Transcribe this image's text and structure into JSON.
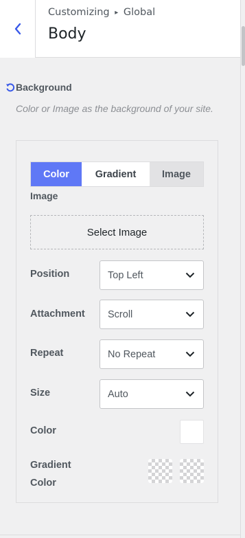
{
  "header": {
    "breadcrumb_parent": "Customizing",
    "breadcrumb_separator": "▸",
    "breadcrumb_child": "Global",
    "title": "Body"
  },
  "section": {
    "label": "Background",
    "description": "Color or Image as the background of your site."
  },
  "tabs": [
    {
      "label": "Color",
      "active": true
    },
    {
      "label": "Gradient",
      "active": false
    },
    {
      "label": "Image",
      "active": false
    }
  ],
  "image": {
    "label": "Image",
    "select_button": "Select Image"
  },
  "fields": {
    "position": {
      "label": "Position",
      "value": "Top Left"
    },
    "attachment": {
      "label": "Attachment",
      "value": "Scroll"
    },
    "repeat": {
      "label": "Repeat",
      "value": "No Repeat"
    },
    "size": {
      "label": "Size",
      "value": "Auto"
    },
    "color": {
      "label": "Color",
      "value": "#ffffff"
    },
    "gradient": {
      "label_line1": "Gradient",
      "label_line2": "Color"
    }
  },
  "colors": {
    "accent": "#5f78f6",
    "back_arrow": "#3858e9"
  },
  "icons": {
    "back": "chevron-left-icon",
    "reset": "reset-icon",
    "dropdown": "chevron-down-icon"
  }
}
